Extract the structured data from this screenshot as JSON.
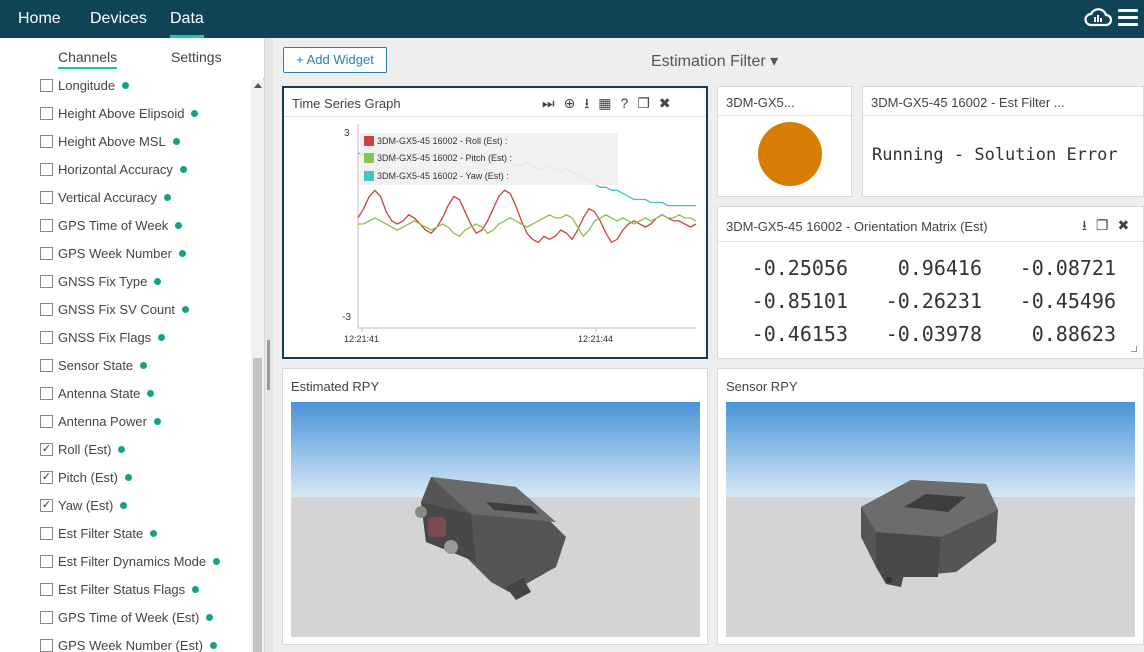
{
  "nav": {
    "home": "Home",
    "devices": "Devices",
    "data": "Data"
  },
  "left_panel": {
    "tabs": [
      "Channels",
      "Settings"
    ],
    "active_tab": "Channels",
    "channels": [
      {
        "label": "Longitude",
        "checked": false
      },
      {
        "label": "Height Above Elipsoid",
        "checked": false
      },
      {
        "label": "Height Above MSL",
        "checked": false
      },
      {
        "label": "Horizontal Accuracy",
        "checked": false
      },
      {
        "label": "Vertical Accuracy",
        "checked": false
      },
      {
        "label": "GPS Time of Week",
        "checked": false
      },
      {
        "label": "GPS Week Number",
        "checked": false
      },
      {
        "label": "GNSS Fix Type",
        "checked": false
      },
      {
        "label": "GNSS Fix SV Count",
        "checked": false
      },
      {
        "label": "GNSS Fix Flags",
        "checked": false
      },
      {
        "label": "Sensor State",
        "checked": false
      },
      {
        "label": "Antenna State",
        "checked": false
      },
      {
        "label": "Antenna Power",
        "checked": false
      },
      {
        "label": "Roll (Est)",
        "checked": true
      },
      {
        "label": "Pitch (Est)",
        "checked": true
      },
      {
        "label": "Yaw (Est)",
        "checked": true
      },
      {
        "label": "Est Filter State",
        "checked": false
      },
      {
        "label": "Est Filter Dynamics Mode",
        "checked": false
      },
      {
        "label": "Est Filter Status Flags",
        "checked": false
      },
      {
        "label": "GPS Time of Week (Est)",
        "checked": false
      },
      {
        "label": "GPS Week Number (Est)",
        "checked": false
      }
    ]
  },
  "toolbar": {
    "add_widget": "+ Add Widget",
    "filter_title": "Estimation Filter ▾"
  },
  "time_series": {
    "title": "Time Series Graph",
    "icons": [
      "⏭",
      "⊕",
      "⭳",
      "▦",
      "?",
      "❐",
      "✖"
    ],
    "legend": [
      {
        "label": "3DM-GX5-45 16002 - Roll (Est) :",
        "color": "#d04040"
      },
      {
        "label": "3DM-GX5-45 16002 - Pitch (Est) :",
        "color": "#8ac24a"
      },
      {
        "label": "3DM-GX5-45 16002 - Yaw (Est) :",
        "color": "#45c1c8"
      }
    ],
    "y_top_label": "3",
    "y_bottom_label": "-3",
    "x_labels": [
      "12:21:41",
      "12:21:44"
    ]
  },
  "chart_data": {
    "type": "line",
    "x": [
      0,
      1,
      2,
      3,
      4,
      5,
      6,
      7,
      8,
      9,
      10,
      11,
      12,
      13,
      14,
      15,
      16,
      17,
      18,
      19,
      20,
      21,
      22,
      23,
      24,
      25,
      26,
      27,
      28,
      29,
      30,
      31,
      32,
      33,
      34,
      35,
      36,
      37,
      38,
      39,
      40,
      41,
      42,
      43,
      44,
      45,
      46,
      47,
      48,
      49,
      50,
      51,
      52,
      53,
      54,
      55,
      56,
      57,
      58,
      59,
      60
    ],
    "xtick_labels": [
      "12:21:41",
      "12:21:44"
    ],
    "ylim": [
      -3,
      3
    ],
    "ytick_labels": [
      "3",
      "-3"
    ],
    "series": [
      {
        "name": "3DM-GX5-45 16002 - Roll (Est) :",
        "color": "#d04040",
        "values": [
          0.2,
          0.5,
          0.9,
          1.1,
          0.9,
          0.4,
          0.1,
          0.0,
          0.1,
          0.3,
          0.2,
          0.0,
          -0.2,
          -0.3,
          -0.1,
          0.2,
          0.6,
          0.9,
          0.8,
          0.4,
          0.0,
          -0.3,
          -0.2,
          0.1,
          0.5,
          0.9,
          1.1,
          1.0,
          0.6,
          0.1,
          -0.3,
          -0.5,
          -0.6,
          -0.4,
          -0.5,
          -0.4,
          -0.2,
          -0.3,
          -0.5,
          -0.2,
          0.2,
          0.5,
          0.4,
          0.1,
          -0.3,
          -0.6,
          -0.5,
          -0.2,
          0.0,
          0.1,
          0.0,
          -0.1,
          0.0,
          0.2,
          0.3,
          0.2,
          0.1,
          0.1,
          0.0,
          -0.1,
          0.0
        ]
      },
      {
        "name": "3DM-GX5-45 16002 - Pitch (Est) :",
        "color": "#8ac24a",
        "values": [
          0.0,
          0.0,
          0.1,
          0.2,
          0.1,
          0.0,
          -0.1,
          -0.2,
          -0.1,
          0.0,
          0.1,
          0.0,
          -0.1,
          -0.2,
          -0.1,
          0.0,
          -0.1,
          -0.3,
          -0.4,
          -0.2,
          -0.1,
          0.0,
          -0.1,
          -0.3,
          -0.2,
          0.0,
          0.1,
          0.2,
          0.1,
          0.0,
          -0.1,
          0.0,
          0.1,
          0.2,
          0.3,
          0.2,
          0.2,
          0.3,
          0.2,
          -0.1,
          -0.4,
          -0.2,
          0.1,
          0.2,
          0.3,
          0.2,
          0.1,
          0.2,
          0.1,
          0.0,
          0.1,
          0.2,
          0.1,
          0.2,
          0.3,
          0.2,
          0.2,
          0.3,
          0.2,
          0.2,
          0.1
        ]
      },
      {
        "name": "3DM-GX5-45 16002 - Yaw (Est) :",
        "color": "#45c1c8",
        "values": [
          2.3,
          2.3,
          2.3,
          2.3,
          2.3,
          2.2,
          2.3,
          2.3,
          2.2,
          2.3,
          2.3,
          2.3,
          2.2,
          2.2,
          2.3,
          2.2,
          2.2,
          2.3,
          2.2,
          2.1,
          2.1,
          2.2,
          2.1,
          2.0,
          2.0,
          2.1,
          2.1,
          2.0,
          1.9,
          1.9,
          2.0,
          1.9,
          1.8,
          1.8,
          1.9,
          1.8,
          1.7,
          1.8,
          1.7,
          1.6,
          1.5,
          1.4,
          1.3,
          1.2,
          1.2,
          1.1,
          1.1,
          1.0,
          0.9,
          0.8,
          0.8,
          0.8,
          0.7,
          0.7,
          0.7,
          0.6,
          0.6,
          0.6,
          0.6,
          0.6,
          0.6
        ]
      }
    ]
  },
  "status_widget": {
    "title": "3DM-GX5...",
    "color": "#d77d04"
  },
  "filter_state_widget": {
    "title": "3DM-GX5-45 16002 - Est Filter ...",
    "value": "Running - Solution Error"
  },
  "matrix_widget": {
    "title": "3DM-GX5-45 16002 - Orientation Matrix (Est)",
    "icons": [
      "⭳",
      "❐",
      "✖"
    ],
    "rows": [
      [
        "-0.25056",
        "0.96416",
        "-0.08721"
      ],
      [
        "-0.85101",
        "-0.26231",
        "-0.45496"
      ],
      [
        "-0.46153",
        "-0.03978",
        "0.88623"
      ]
    ]
  },
  "estimated_rpy": {
    "title": "Estimated RPY"
  },
  "sensor_rpy": {
    "title": "Sensor RPY"
  }
}
